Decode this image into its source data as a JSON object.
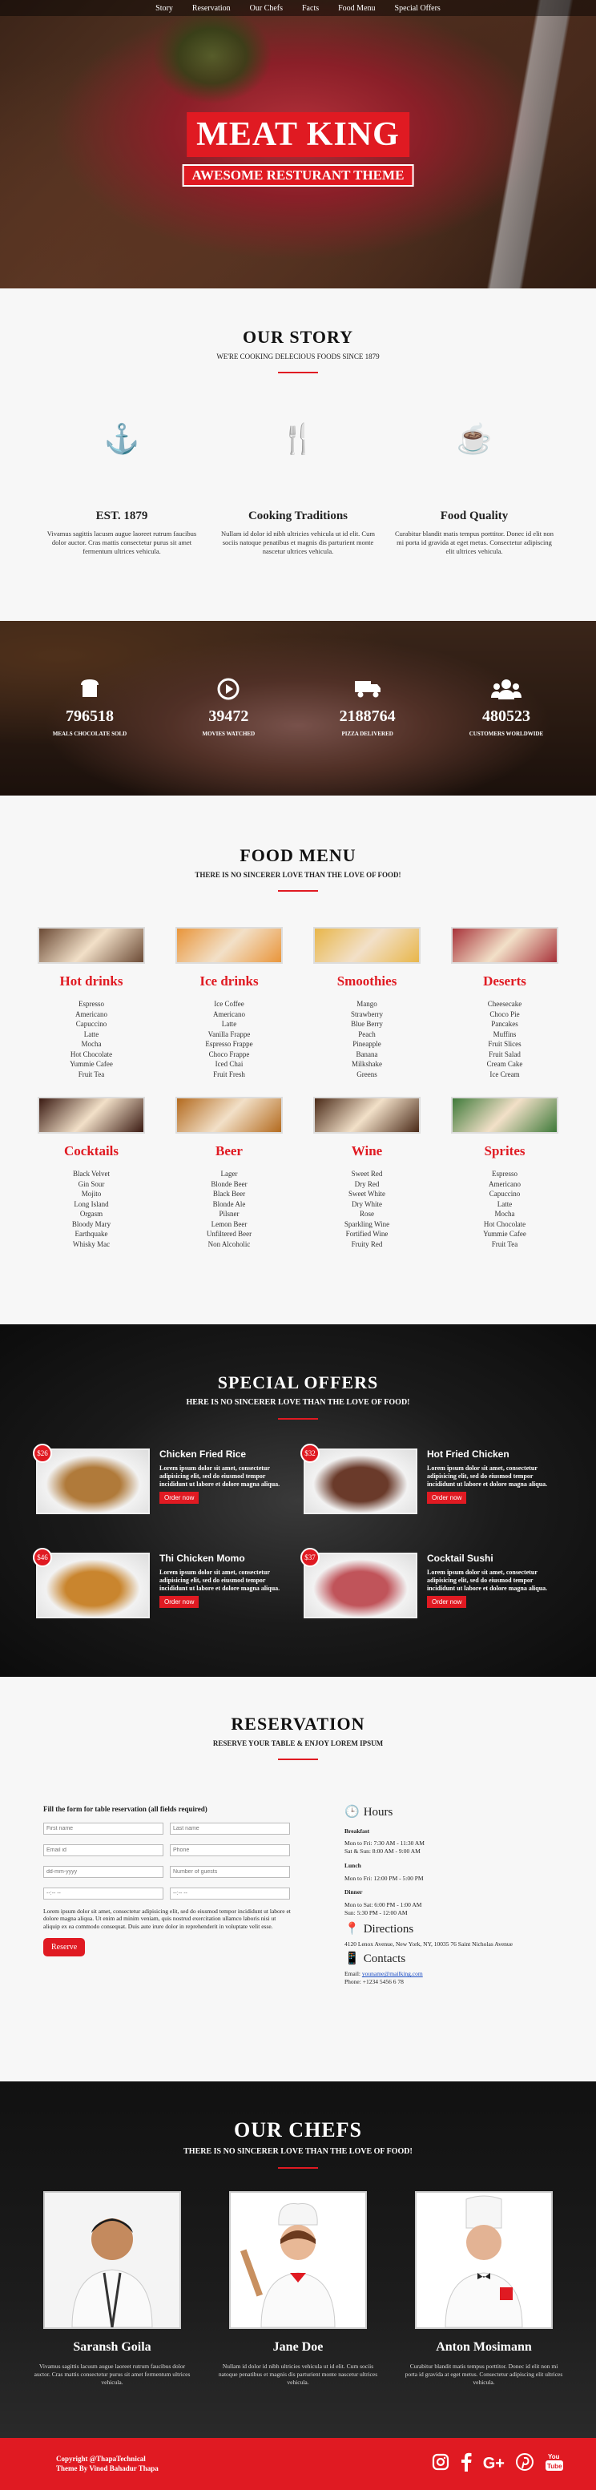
{
  "nav": [
    "Story",
    "Reservation",
    "Our Chefs",
    "Facts",
    "Food Menu",
    "Special Offers"
  ],
  "hero": {
    "title": "MEAT KING",
    "subtitle": "AWESOME RESTURANT THEME"
  },
  "story": {
    "title": "OUR STORY",
    "subtitle": "WE'RE COOKING DELECIOUS FOODS SINCE 1879",
    "items": [
      {
        "icon": "anchor-icon",
        "title": "EST. 1879",
        "text": "Vivamus sagittis lacusm augue laoreet rutrum faucibus dolor auctor. Cras mattis consectetur purus sit amet fermentum ultrices vehicula."
      },
      {
        "icon": "cutlery-icon",
        "title": "Cooking Traditions",
        "text": "Nullam id dolor id nibh ultricies vehicula ut id elit. Cum sociis natoque penatibus et magnis dis parturient monte nascetur ultrices vehicula."
      },
      {
        "icon": "coffee-cup-icon",
        "title": "Food Quality",
        "text": "Curabitur blandit matis tempus porttitor. Donec id elit non mi porta id gravida at eget metus. Consectetur adipiscing elit ultrices vehicula."
      }
    ]
  },
  "stats": [
    {
      "icon": "bread-icon",
      "number": "796518",
      "label": "MEALS CHOCOLATE SOLD"
    },
    {
      "icon": "play-icon",
      "number": "39472",
      "label": "MOVIES WATCHED"
    },
    {
      "icon": "truck-icon",
      "number": "2188764",
      "label": "PIZZA DELIVERED"
    },
    {
      "icon": "users-icon",
      "number": "480523",
      "label": "CUSTOMERS WORLDWIDE"
    }
  ],
  "menu": {
    "title": "FOOD MENU",
    "subtitle": "THERE IS NO SINCERER LOVE THAN THE LOVE OF FOOD!",
    "categories": [
      {
        "name": "Hot drinks",
        "color": "#6b4a35",
        "items": [
          "Espresso",
          "Americano",
          "Capuccino",
          "Latte",
          "Mocha",
          "Hot Chocolate",
          "Yummie Cafee",
          "Fruit Tea"
        ]
      },
      {
        "name": "Ice drinks",
        "color": "#e9953a",
        "items": [
          "Ice Coffee",
          "Americano",
          "Latte",
          "Vanilla Frappe",
          "Espresso Frappe",
          "Choco Frappe",
          "Iced Chai",
          "Fruit Fresh"
        ]
      },
      {
        "name": "Smoothies",
        "color": "#e8b64a",
        "items": [
          "Mango",
          "Strawberry",
          "Blue Berry",
          "Peach",
          "Pineapple",
          "Banana",
          "Milkshake",
          "Greens"
        ]
      },
      {
        "name": "Deserts",
        "color": "#a8333a",
        "items": [
          "Cheesecake",
          "Choco Pie",
          "Pancakes",
          "Muffins",
          "Fruit Slices",
          "Fruit Salad",
          "Cream Cake",
          "Ice Cream"
        ]
      },
      {
        "name": "Cocktails",
        "color": "#3a1a12",
        "items": [
          "Black Velvet",
          "Gin Sour",
          "Mojito",
          "Long Island",
          "Orgasm",
          "Bloody Mary",
          "Earthquake",
          "Whisky Mac"
        ]
      },
      {
        "name": "Beer",
        "color": "#b36a1e",
        "items": [
          "Lager",
          "Blonde Beer",
          "Black Beer",
          "Blonde Ale",
          "Pilsner",
          "Lemon Beer",
          "Unfiltered Beer",
          "Non Alcoholic"
        ]
      },
      {
        "name": "Wine",
        "color": "#4a2a18",
        "items": [
          "Sweet Red",
          "Dry Red",
          "Sweet White",
          "Dry White",
          "Rose",
          "Sparkling Wine",
          "Fortified Wine",
          "Fruity Red"
        ]
      },
      {
        "name": "Sprites",
        "color": "#3f7a3a",
        "items": [
          "Espresso",
          "Americano",
          "Capuccino",
          "Latte",
          "Mocha",
          "Hot Chocolate",
          "Yummie Cafee",
          "Fruit Tea"
        ]
      }
    ]
  },
  "offers": {
    "title": "SPECIAL OFFERS",
    "subtitle": "HERE IS NO SINCERER LOVE THAN THE LOVE OF FOOD!",
    "order_label": "Order now",
    "items": [
      {
        "price": "$26",
        "title": "Chicken Fried Rice",
        "color": "#b07a3a",
        "text": "Lorem ipsum dolor sit amet, consectetur adipisicing elit, sed do eiusmod tempor incididunt ut labore et dolore magna aliqua."
      },
      {
        "price": "$32",
        "title": "Hot Fried Chicken",
        "color": "#6a3a2a",
        "text": "Lorem ipsum dolor sit amet, consectetur adipisicing elit, sed do eiusmod tempor incididunt ut labore et dolore magna aliqua."
      },
      {
        "price": "$46",
        "title": "Thi Chicken Momo",
        "color": "#c9852e",
        "text": "Lorem ipsum dolor sit amet, consectetur adipisicing elit, sed do eiusmod tempor incididunt ut labore et dolore magna aliqua."
      },
      {
        "price": "$37",
        "title": "Cocktail Sushi",
        "color": "#c0545a",
        "text": "Lorem ipsum dolor sit amet, consectetur adipisicing elit, sed do eiusmod tempor incididunt ut labore et dolore magna aliqua."
      }
    ]
  },
  "reservation": {
    "title": "RESERVATION",
    "subtitle": "RESERVE YOUR TABLE & ENJOY LOREM IPSUM",
    "form_heading": "Fill the form for table reservation (all fields required)",
    "placeholders": [
      "First name",
      "Last name",
      "Email id",
      "Phone",
      "dd-mm-yyyy",
      "Number of guests",
      "--:-- --",
      "--:-- --"
    ],
    "note": "Lorem ipsum dolor sit amet, consectetur adipisicing elit, sed do eiusmod tempor incididunt ut labore et dolore magna aliqua. Ut enim ad minim veniam, quis nostrud exercitation ullamco laboris nisi ut aliquip ex ea commodo consequat. Duis aute irure dolor in reprehenderit in voluptate velit esse.",
    "button": "Reserve",
    "hours_title": "Hours",
    "breakfast_label": "Breakfast",
    "breakfast_1": "Mon to Fri: 7:30 AM - 11:30 AM",
    "breakfast_2": "Sat & Sun: 8:00 AM - 9:00 AM",
    "lunch_label": "Lunch",
    "lunch_1": "Mon to Fri: 12:00 PM - 5:00 PM",
    "dinner_label": "Dinner",
    "dinner_1": "Mon to Sat: 6:00 PM - 1:00 AM",
    "dinner_2": "Sun: 5:30 PM - 12:00 AM",
    "directions_title": "Directions",
    "directions_text": "4120 Lenox Avenue, New York, NY, 10035 76 Saint Nicholas Avenue",
    "contacts_title": "Contacts",
    "email_label": "Email:",
    "email": "youname@mailking.com",
    "phone": "Phone: +1234 5456 6 78"
  },
  "chefs": {
    "title": "OUR CHEFS",
    "subtitle": "THERE IS NO SINCERER LOVE THAN THE LOVE OF FOOD!",
    "items": [
      {
        "name": "Saransh Goila",
        "text": "Vivamus sagittis lacusm augue laoreet rutrum faucibus dolor auctor. Cras mattis consectetur purus sit amet fermentum ultrices vehicula."
      },
      {
        "name": "Jane Doe",
        "text": "Nullam id dolor id nibh ultricies vehicula ut id elit. Cum sociis natoque penatibus et magnis dis parturient monte nascetur ultrices vehicula."
      },
      {
        "name": "Anton Mosimann",
        "text": "Curabitur blandit matis tempus porttitor. Donec id elit non mi porta id gravida at eget metus. Consectetur adipiscing elit ultrices vehicula."
      }
    ]
  },
  "footer": {
    "copyright": "Copyright @ThapaTechnical",
    "credit": "Theme By Vinod Bahadur Thapa"
  },
  "colors": {
    "accent": "#e01a22",
    "dark": "#111111",
    "light_bg": "#f7f7f7"
  }
}
